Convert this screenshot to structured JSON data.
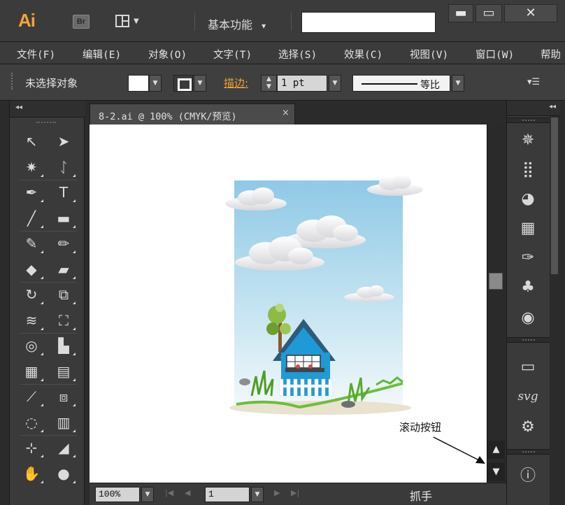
{
  "app": {
    "logo": "Ai",
    "bridge_label": "Br",
    "workspace": "基本功能",
    "workspace_caret": "▾",
    "search_value": "",
    "window_buttons": {
      "minimize": "▬",
      "maximize": "▭",
      "close": "✕"
    }
  },
  "menu": [
    "文件(F)",
    "编辑(E)",
    "对象(O)",
    "文字(T)",
    "选择(S)",
    "效果(C)",
    "视图(V)",
    "窗口(W)",
    "帮助"
  ],
  "control": {
    "selection_status": "未选择对象",
    "stroke_label": "描边:",
    "stroke_weight": "1 pt",
    "variable_width_profile": "等比",
    "panel_menu_icon": "▾☰"
  },
  "document": {
    "tab_name": "8-2.ai @ 100% (CMYK/预览)",
    "tab_close": "×",
    "zoom": "100%",
    "page": "1",
    "current_tool": "抓手"
  },
  "annotation": {
    "text": "滚动按钮"
  },
  "tools": [
    {
      "name": "selection-tool",
      "glyph": "↖"
    },
    {
      "name": "direct-selection-tool",
      "glyph": "➤"
    },
    {
      "name": "magic-wand-tool",
      "glyph": "✷"
    },
    {
      "name": "lasso-tool",
      "glyph": "ᛇ"
    },
    {
      "name": "pen-tool",
      "glyph": "✒"
    },
    {
      "name": "type-tool",
      "glyph": "T"
    },
    {
      "name": "line-segment-tool",
      "glyph": "╱"
    },
    {
      "name": "rectangle-tool",
      "glyph": "▬"
    },
    {
      "name": "paintbrush-tool",
      "glyph": "✎"
    },
    {
      "name": "pencil-tool",
      "glyph": "✏"
    },
    {
      "name": "blob-brush-tool",
      "glyph": "◆"
    },
    {
      "name": "eraser-tool",
      "glyph": "▰"
    },
    {
      "name": "rotate-tool",
      "glyph": "↻"
    },
    {
      "name": "scale-tool",
      "glyph": "⧉"
    },
    {
      "name": "width-tool",
      "glyph": "≋"
    },
    {
      "name": "free-transform-tool",
      "glyph": "⛶"
    },
    {
      "name": "shape-builder-tool",
      "glyph": "◎"
    },
    {
      "name": "perspective-grid-tool",
      "glyph": "▙"
    },
    {
      "name": "mesh-tool",
      "glyph": "▦"
    },
    {
      "name": "gradient-tool",
      "glyph": "▤"
    },
    {
      "name": "eyedropper-tool",
      "glyph": "⟋"
    },
    {
      "name": "blend-tool",
      "glyph": "⧈"
    },
    {
      "name": "symbol-sprayer-tool",
      "glyph": "◌"
    },
    {
      "name": "column-graph-tool",
      "glyph": "▥"
    },
    {
      "name": "artboard-tool",
      "glyph": "⊹"
    },
    {
      "name": "slice-tool",
      "glyph": "◢"
    },
    {
      "name": "hand-tool",
      "glyph": "✋"
    },
    {
      "name": "zoom-tool",
      "glyph": "●"
    }
  ],
  "dock": [
    {
      "name": "brushes-panel-icon",
      "glyph": "✵"
    },
    {
      "name": "symbols-panel-icon",
      "glyph": "⣿"
    },
    {
      "name": "color-guide-panel-icon",
      "glyph": "◕"
    },
    {
      "name": "swatches-panel-icon",
      "glyph": "▦"
    },
    {
      "name": "brush-library-panel-icon",
      "glyph": "✑"
    },
    {
      "name": "symbol-library-panel-icon",
      "glyph": "♣"
    },
    {
      "name": "appearance-panel-icon",
      "glyph": "◉"
    },
    {
      "name": "gradient-panel-icon",
      "glyph": "▭"
    },
    {
      "name": "svg-interactivity-panel-icon",
      "glyph": "svg"
    },
    {
      "name": "graphic-styles-panel-icon",
      "glyph": "⚙"
    },
    {
      "name": "document-info-panel-icon",
      "glyph": "ⓘ"
    }
  ]
}
